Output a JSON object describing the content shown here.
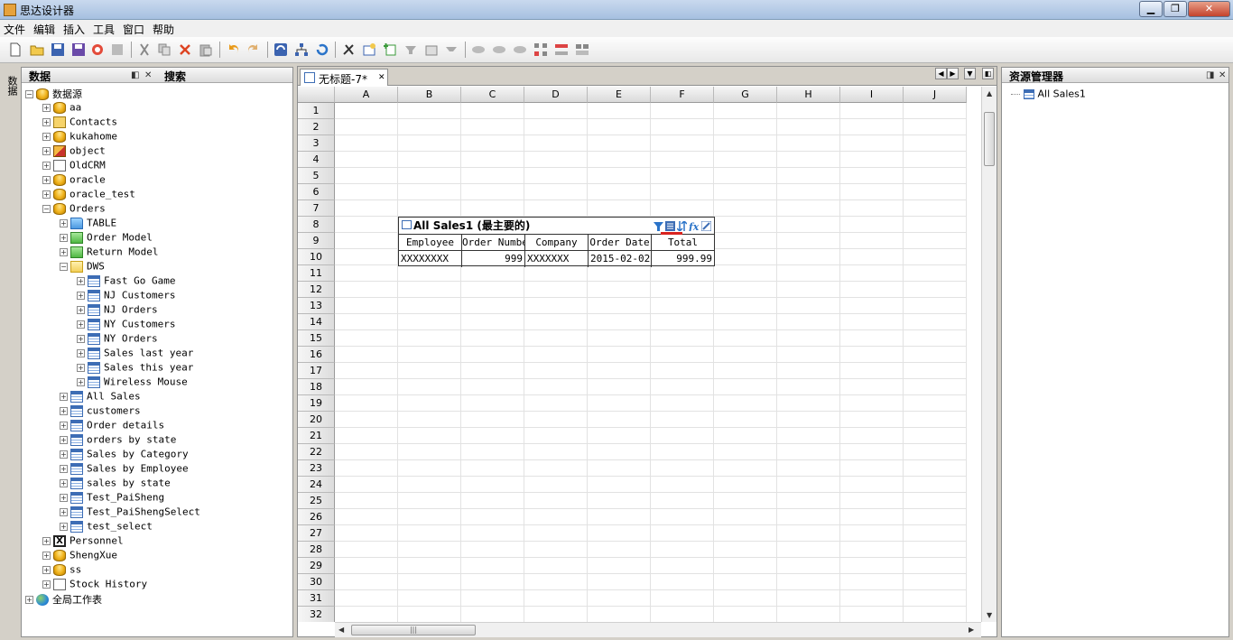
{
  "window": {
    "title": "思达设计器",
    "minimize": "▁",
    "maximize": "❐",
    "close": "✕"
  },
  "menu": [
    "文件",
    "编辑",
    "插入",
    "工具",
    "窗口",
    "帮助"
  ],
  "toolbar_icons": [
    "new-icon",
    "open-icon",
    "save-icon",
    "save-all-icon",
    "refresh-icon",
    "disabled-icon",
    "cut-icon",
    "copy-icon",
    "delete-icon",
    "paste-icon",
    "undo-icon",
    "redo-icon",
    "sync-icon",
    "tree-icon",
    "reload-icon",
    "tool-icon",
    "add-table-icon",
    "add-column-icon",
    "filter-icon",
    "edit-icon",
    "sort-icon",
    "link-icon",
    "chain-icon",
    "chain2-icon",
    "group-icon",
    "split-icon",
    "layout-icon"
  ],
  "left_vertical_tab": "数据",
  "left_panel": {
    "tab_data": "数据",
    "tab_search": "搜索",
    "pin": "◧",
    "close": "✕",
    "tree": [
      {
        "level": 0,
        "icon": "db",
        "label": "数据源",
        "exp": "−"
      },
      {
        "level": 1,
        "icon": "db",
        "label": "aa",
        "exp": "+"
      },
      {
        "level": 1,
        "icon": "contact",
        "label": "Contacts",
        "exp": "+"
      },
      {
        "level": 1,
        "icon": "db",
        "label": "kukahome",
        "exp": "+"
      },
      {
        "level": 1,
        "icon": "obj",
        "label": "object",
        "exp": "+"
      },
      {
        "level": 1,
        "icon": "crm",
        "label": "OldCRM",
        "exp": "+"
      },
      {
        "level": 1,
        "icon": "db",
        "label": "oracle",
        "exp": "+"
      },
      {
        "level": 1,
        "icon": "db",
        "label": "oracle_test",
        "exp": "+"
      },
      {
        "level": 1,
        "icon": "db",
        "label": "Orders",
        "exp": "−"
      },
      {
        "level": 2,
        "icon": "folder",
        "label": "TABLE",
        "exp": "+"
      },
      {
        "level": 2,
        "icon": "folder-green",
        "label": "Order Model",
        "exp": "+"
      },
      {
        "level": 2,
        "icon": "folder-green",
        "label": "Return Model",
        "exp": "+"
      },
      {
        "level": 2,
        "icon": "folder-yellow",
        "label": "DWS",
        "exp": "−"
      },
      {
        "level": 3,
        "icon": "table",
        "label": "Fast Go Game",
        "exp": "+"
      },
      {
        "level": 3,
        "icon": "table",
        "label": "NJ Customers",
        "exp": "+"
      },
      {
        "level": 3,
        "icon": "table",
        "label": "NJ Orders",
        "exp": "+"
      },
      {
        "level": 3,
        "icon": "table",
        "label": "NY Customers",
        "exp": "+"
      },
      {
        "level": 3,
        "icon": "table",
        "label": "NY Orders",
        "exp": "+"
      },
      {
        "level": 3,
        "icon": "table",
        "label": "Sales last year",
        "exp": "+"
      },
      {
        "level": 3,
        "icon": "table",
        "label": "Sales this year",
        "exp": "+"
      },
      {
        "level": 3,
        "icon": "table",
        "label": "Wireless Mouse",
        "exp": "+"
      },
      {
        "level": 2,
        "icon": "table",
        "label": "All Sales",
        "exp": "+"
      },
      {
        "level": 2,
        "icon": "table",
        "label": "customers",
        "exp": "+"
      },
      {
        "level": 2,
        "icon": "table",
        "label": "Order details",
        "exp": "+"
      },
      {
        "level": 2,
        "icon": "table",
        "label": "orders by state",
        "exp": "+"
      },
      {
        "level": 2,
        "icon": "table",
        "label": "Sales by Category",
        "exp": "+"
      },
      {
        "level": 2,
        "icon": "table",
        "label": "Sales by Employee",
        "exp": "+"
      },
      {
        "level": 2,
        "icon": "table",
        "label": "sales by state",
        "exp": "+"
      },
      {
        "level": 2,
        "icon": "table",
        "label": "Test_PaiSheng",
        "exp": "+"
      },
      {
        "level": 2,
        "icon": "table",
        "label": "Test_PaiShengSelect",
        "exp": "+"
      },
      {
        "level": 2,
        "icon": "table",
        "label": "test_select",
        "exp": "+"
      },
      {
        "level": 1,
        "icon": "x",
        "label": "Personnel",
        "exp": "+"
      },
      {
        "level": 1,
        "icon": "db",
        "label": "ShengXue",
        "exp": "+"
      },
      {
        "level": 1,
        "icon": "db",
        "label": "ss",
        "exp": "+"
      },
      {
        "level": 1,
        "icon": "crm",
        "label": "Stock History",
        "exp": "+"
      },
      {
        "level": 0,
        "icon": "globe",
        "label": "全局工作表",
        "exp": "+"
      }
    ]
  },
  "document": {
    "tab_label": "无标题-7*",
    "tab_close": "✕",
    "nav": [
      "◀",
      "▶",
      "▼",
      "◧"
    ],
    "columns": [
      "A",
      "B",
      "C",
      "D",
      "E",
      "F",
      "G",
      "H",
      "I",
      "J"
    ],
    "rows": [
      "1",
      "2",
      "3",
      "4",
      "5",
      "6",
      "7",
      "8",
      "9",
      "10",
      "11",
      "12",
      "13",
      "14",
      "15",
      "16",
      "17",
      "18",
      "19",
      "20",
      "21",
      "22",
      "23",
      "24",
      "25",
      "26",
      "27",
      "28",
      "29",
      "30",
      "31",
      "32"
    ],
    "report": {
      "title": "All Sales1 (最主要的)",
      "headers": [
        "Employee",
        "Order Number",
        "Company",
        "Order Date",
        "Total"
      ],
      "row": [
        "XXXXXXXX",
        "999",
        "XXXXXXX",
        "2015-02-02",
        "999.99"
      ],
      "header_icons": [
        "filter-icon",
        "list-icon",
        "sort-icon",
        "formula-icon",
        "edit-icon"
      ]
    }
  },
  "right_panel": {
    "title": "资源管理器",
    "pin": "◨",
    "close": "✕",
    "items": [
      {
        "icon": "table",
        "label": "All Sales1"
      }
    ]
  },
  "colors": {
    "accent": "#3d6db5",
    "frame": "#d4d0c8",
    "underline": "#d9231f"
  }
}
